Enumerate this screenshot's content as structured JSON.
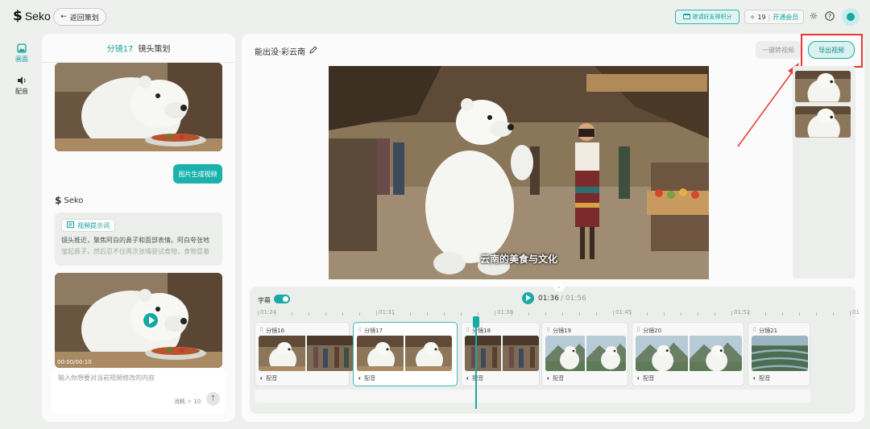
{
  "app": {
    "logo_text": "Seko"
  },
  "header": {
    "back_label": "返回策划",
    "invite_label": "邀请好友得积分",
    "credits_value": "19",
    "vip_label": "开通会员",
    "theme_icon": "sun-icon",
    "help_icon": "help-icon"
  },
  "rail": [
    {
      "label": "画面",
      "icon": "image-icon"
    },
    {
      "label": "配音",
      "icon": "speaker-icon"
    }
  ],
  "left_panel": {
    "shot_label": "分镜17",
    "tab_label": "镜头策划",
    "generate_button": "图片生成视频",
    "assistant_name": "Seko",
    "prompt_tag": "视频提示词",
    "prompt_line1": "镜头推近，聚焦阿白的鼻子和面部表情。阿白夸张地",
    "prompt_line2": "皱起鼻子，然后忍不住再次张嘴尝试食物，食物冒着",
    "video_time": "00:00/00:10",
    "input_placeholder": "输入你想要对当前视频修改的内容",
    "cost_label": "消耗",
    "cost_value": "10"
  },
  "main": {
    "project_title": "能出没·彩云南",
    "one_click_label": "一键转视频",
    "export_label": "导出视频",
    "subtitle_text": "云南的美食与文化"
  },
  "timeline": {
    "subtitle_toggle_label": "字幕",
    "current_time": "01:36",
    "total_time": "/ 01:56",
    "ruler_labels": [
      "01:24",
      "01:31",
      "01:38",
      "01:45",
      "01:52",
      "01"
    ],
    "clips": [
      {
        "label": "分镜16",
        "audio": "配音"
      },
      {
        "label": "分镜17",
        "audio": "配音"
      },
      {
        "label": "分镜18",
        "audio": "配音"
      },
      {
        "label": "分镜19",
        "audio": "配音"
      },
      {
        "label": "分镜20",
        "audio": "配音"
      },
      {
        "label": "分镜21",
        "audio": "配音"
      }
    ]
  },
  "colors": {
    "accent": "#19aaa5",
    "highlight": "#e53935"
  }
}
